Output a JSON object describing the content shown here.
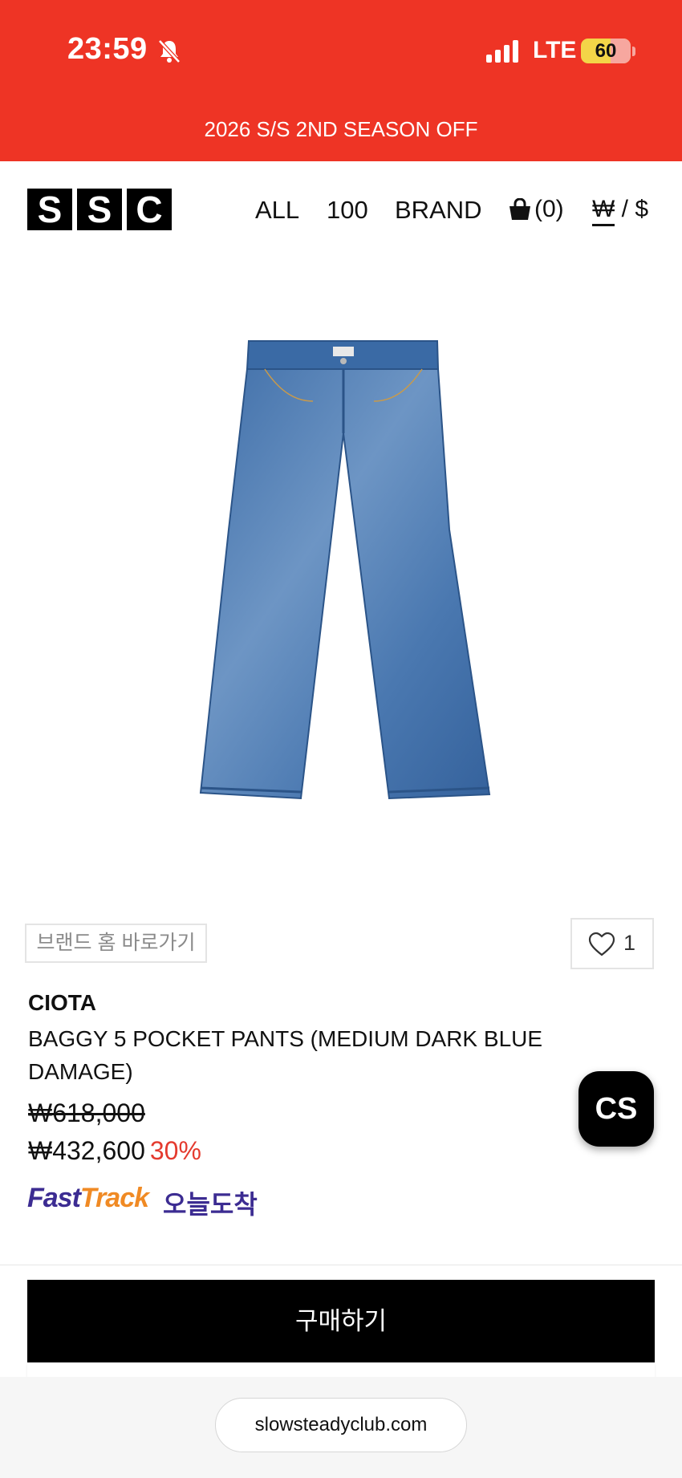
{
  "status_bar": {
    "time": "23:59",
    "network": "LTE",
    "battery": "60",
    "icons": [
      "bell-slash-icon",
      "signal-icon"
    ]
  },
  "promo_banner": {
    "text": "2026 S/S 2ND SEASON OFF"
  },
  "header": {
    "logo_letters": [
      "S",
      "S",
      "C"
    ],
    "nav": {
      "all": "ALL",
      "hundred": "100",
      "brand": "BRAND"
    },
    "cart": {
      "icon": "shopping-bag-icon",
      "count": "(0)"
    },
    "currency": {
      "won": "₩",
      "separator": " / ",
      "dollar": "$"
    }
  },
  "product": {
    "image_icon": "jeans-image",
    "brand_home_label": "브랜드 홈 바로가기",
    "like": {
      "icon": "heart-icon",
      "count": "1"
    },
    "brand": "CIOTA",
    "name": "BAGGY 5 POCKET PANTS (MEDIUM DARK BLUE DAMAGE)",
    "original_price": "₩618,000",
    "sale_price": "₩432,600",
    "discount": "30%",
    "fasttrack": {
      "fast": "Fast",
      "track": "Track",
      "label": "오늘도착"
    }
  },
  "cs_button": {
    "label": "CS"
  },
  "buy_button": {
    "label": "구매하기"
  },
  "browser": {
    "url": "slowsteadyclub.com"
  },
  "colors": {
    "accent_red": "#ee3425",
    "discount_red": "#e43a2e",
    "fasttrack_purple": "#3c2c92",
    "fasttrack_orange": "#f08a24"
  }
}
